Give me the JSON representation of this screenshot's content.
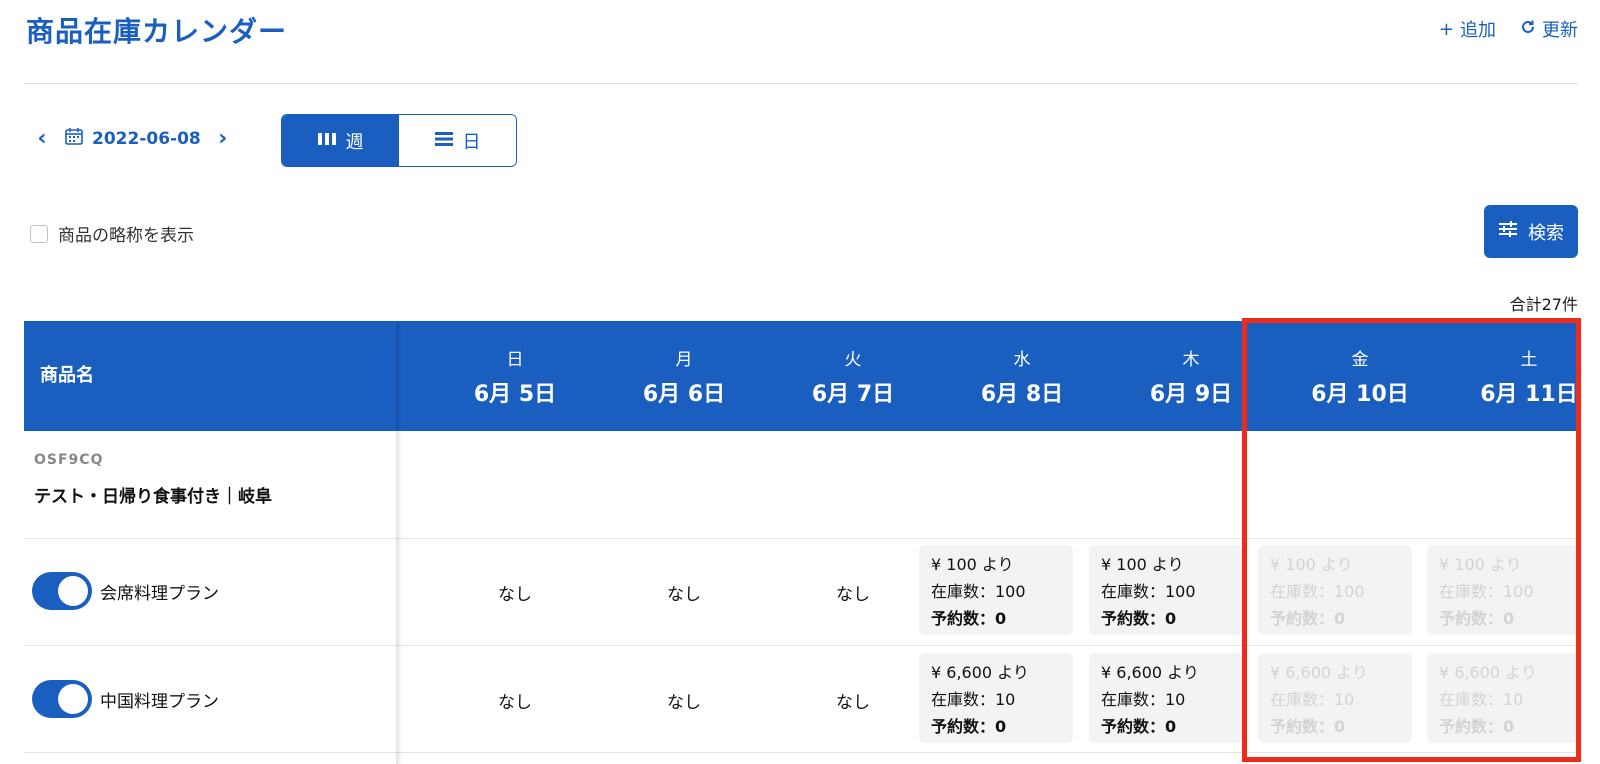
{
  "header": {
    "title": "商品在庫カレンダー",
    "add_label": "追加",
    "refresh_label": "更新"
  },
  "nav": {
    "date": "2022-06-08",
    "views": {
      "week": "週",
      "day": "日"
    },
    "active_view": "week"
  },
  "filters": {
    "abbr_label": "商品の略称を表示",
    "abbr_checked": false,
    "search_label": "検索"
  },
  "total": "合計27件",
  "table": {
    "name_header": "商品名",
    "days": [
      {
        "weekday": "日",
        "date": "6月 5日"
      },
      {
        "weekday": "月",
        "date": "6月 6日"
      },
      {
        "weekday": "火",
        "date": "6月 7日"
      },
      {
        "weekday": "水",
        "date": "6月 8日"
      },
      {
        "weekday": "木",
        "date": "6月 9日"
      },
      {
        "weekday": "金",
        "date": "6月 10日"
      },
      {
        "weekday": "土",
        "date": "6月 11日"
      }
    ]
  },
  "product": {
    "code": "OSF9CQ",
    "name": "テスト・日帰り食事付き｜岐阜"
  },
  "plans": [
    {
      "name": "会席料理プラン",
      "enabled": true,
      "none_label": "なし",
      "price": "¥ 100 より",
      "stock": "在庫数：100",
      "reserved": "予約数：0"
    },
    {
      "name": "中国料理プラン",
      "enabled": true,
      "none_label": "なし",
      "price": "¥ 6,600 より",
      "stock": "在庫数：10",
      "reserved": "予約数：0"
    }
  ],
  "colors": {
    "primary": "#1a5fbf",
    "highlight": "#ee2b19",
    "cell_bg": "#f3f3f3",
    "disabled_text": "#d3d3d3"
  }
}
